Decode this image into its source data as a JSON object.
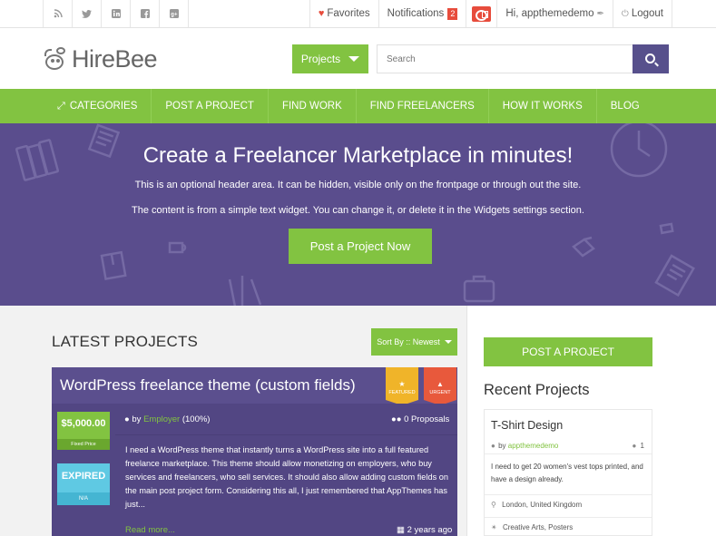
{
  "topbar": {
    "social": [
      {
        "icon": "rss-icon",
        "glyph": "◔"
      },
      {
        "icon": "twitter-icon",
        "glyph": "❧"
      },
      {
        "icon": "linkedin-icon",
        "glyph": "in"
      },
      {
        "icon": "facebook-icon",
        "glyph": "f"
      },
      {
        "icon": "google-plus-icon",
        "glyph": "g+"
      }
    ],
    "favorites": "Favorites",
    "notifications": "Notifications",
    "notifications_count": "2",
    "user": "Hi, appthemedemo",
    "logout": "Logout"
  },
  "header": {
    "logo_text": "HireBee",
    "projects_dropdown": "Projects",
    "search_placeholder": "Search"
  },
  "nav": {
    "items": [
      "CATEGORIES",
      "POST A PROJECT",
      "FIND WORK",
      "FIND FREELANCERS",
      "HOW IT WORKS",
      "BLOG"
    ]
  },
  "hero": {
    "title": "Create a Freelancer Marketplace in minutes!",
    "line1": "This is an optional header area. It can be hidden, visible only on the frontpage or through out the site.",
    "line2": "The content is from a simple text widget. You can change it, or delete it in the Widgets settings section.",
    "button": "Post a Project Now"
  },
  "main": {
    "heading": "LATEST PROJECTS",
    "sort_label": "Sort By :: Newest",
    "project": {
      "title": "WordPress freelance theme (custom fields)",
      "ribbon_featured": "FEATURED",
      "ribbon_urgent": "URGENT",
      "price": "$5,000.00",
      "price_type": "Fixed Price",
      "status": "EXPIRED",
      "status_sub": "N/A",
      "by_prefix": "by",
      "employer": "Employer",
      "rating": "(100%)",
      "proposals": "0 Proposals",
      "description": "I need a WordPress theme that instantly turns a WordPress site into a full featured freelance marketplace. This theme should allow monetizing on employers, who buy services and freelancers, who sell services. It should also allow adding custom fields on the main post project form. Considering this all, I just remembered that AppThemes has just...",
      "read_more": "Read more...",
      "posted": "2 years ago"
    }
  },
  "sidebar": {
    "post_button": "POST A PROJECT",
    "recent_title": "Recent Projects",
    "recent": {
      "title": "T-Shirt Design",
      "by_prefix": "by",
      "author": "appthemedemo",
      "count": "1",
      "description": "I need to get 20 women's vest tops printed, and have a design already.",
      "location": "London, United Kingdom",
      "categories": "Creative Arts, Posters"
    }
  },
  "colors": {
    "green": "#82c341",
    "purple": "#5a4d8d",
    "red": "#e74c3c",
    "featured": "#f0b429",
    "urgent": "#e8593c",
    "expired": "#5fc9e3"
  }
}
